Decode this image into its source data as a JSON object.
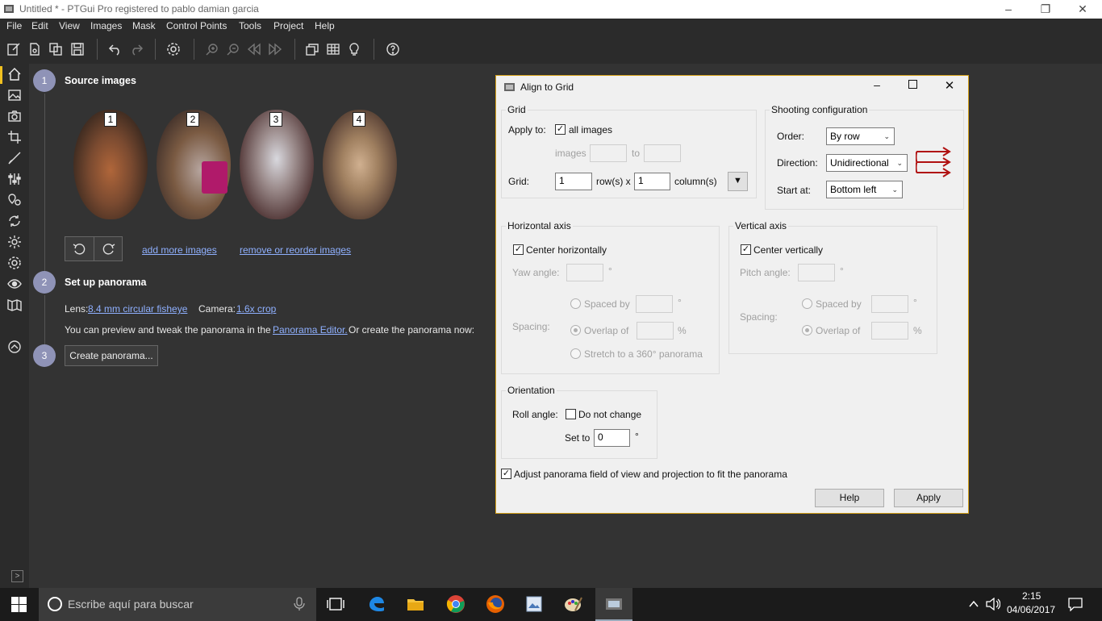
{
  "window": {
    "title": "Untitled * - PTGui Pro registered to pablo damian garcia"
  },
  "menu": [
    "File",
    "Edit",
    "View",
    "Images",
    "Mask",
    "Control Points",
    "Tools",
    "Project",
    "Help"
  ],
  "steps": {
    "s1": {
      "num": "1",
      "title": "Source images"
    },
    "s2": {
      "num": "2",
      "title": "Set up panorama"
    },
    "s3": {
      "num": "3",
      "button": "Create panorama..."
    }
  },
  "thumbnails": [
    "1",
    "2",
    "3",
    "4"
  ],
  "links": {
    "add": "add more images",
    "remove": "remove or reorder images",
    "lens": "8.4 mm circular fisheye",
    "camera": "1.6x crop",
    "editor": "Panorama Editor."
  },
  "labels": {
    "lens": "Lens:",
    "camera": "Camera:",
    "preview_before": "You can preview and tweak the panorama in the",
    "preview_after": "Or create the panorama now:"
  },
  "dialog": {
    "title": "Align to Grid",
    "grid": {
      "group": "Grid",
      "apply_to": "Apply to:",
      "all_images": "all images",
      "images": "images",
      "to": "to",
      "grid": "Grid:",
      "rows": "1",
      "rows_label": "row(s) x",
      "cols": "1",
      "cols_label": "column(s)"
    },
    "shooting": {
      "group": "Shooting configuration",
      "order_label": "Order:",
      "order": "By row",
      "direction_label": "Direction:",
      "direction": "Unidirectional",
      "start_label": "Start at:",
      "start": "Bottom left"
    },
    "horizontal": {
      "group": "Horizontal axis",
      "center": "Center horizontally",
      "yaw": "Yaw angle:",
      "deg": "°",
      "spacing": "Spacing:",
      "spaced_by": "Spaced by",
      "overlap": "Overlap of",
      "pct": "%",
      "stretch": "Stretch to a 360° panorama"
    },
    "vertical": {
      "group": "Vertical axis",
      "center": "Center vertically",
      "pitch": "Pitch angle:",
      "deg": "°",
      "spacing": "Spacing:",
      "spaced_by": "Spaced by",
      "overlap": "Overlap of",
      "pct": "%"
    },
    "orientation": {
      "group": "Orientation",
      "roll": "Roll angle:",
      "no_change": "Do not change",
      "set_to": "Set to",
      "value": "0",
      "deg": "°"
    },
    "adjust": "Adjust panorama field of view and projection to fit the panorama",
    "help": "Help",
    "apply": "Apply"
  },
  "taskbar": {
    "search": "Escribe aquí para buscar",
    "time": "2:15",
    "date": "04/06/2017"
  },
  "colors": {
    "accent": "#8f93b7",
    "link": "#8fb0ff",
    "dialog_border": "#d4a017"
  }
}
